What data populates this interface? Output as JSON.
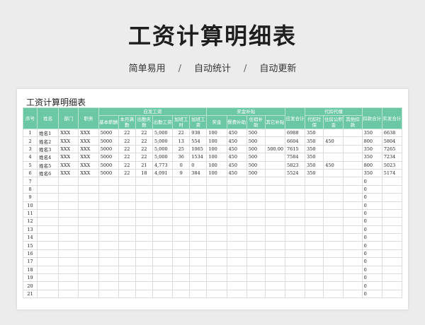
{
  "banner": {
    "title": "工资计算明细表",
    "features": [
      "简单易用",
      "自动统计",
      "自动更新"
    ],
    "separator": "/"
  },
  "sheet": {
    "title": "工资计算明细表",
    "headers": {
      "index": "序号",
      "name": "姓名",
      "dept": "部门",
      "position": "职务",
      "payable_group": "应发工资",
      "base_salary": "基本薪酬",
      "month_days": "本月满勤",
      "attendance_days": "出勤天数",
      "attendance_pay": "出勤工资",
      "overtime_hours": "加班工时",
      "overtime_pay": "加班工资",
      "bonus_group": "奖金补贴",
      "bonus": "奖金",
      "meal_allowance": "餐费补助",
      "housing_allowance": "住宿补助",
      "other_allowance": "其它补贴",
      "gross_total": "应发合计",
      "withhold_group": "代扣代缴",
      "social_insurance": "代扣社保",
      "housing_fund": "住房公积金",
      "other_deduction": "其他扣款",
      "deduction_total": "扣款合计",
      "net_total": "实发合计"
    },
    "rows": [
      {
        "no": "1",
        "name": "姓名1",
        "dept": "XXX",
        "position": "XXX",
        "base": "5000",
        "month_days": "22",
        "days": "22",
        "att_pay": "5,000",
        "ot_hours": "22",
        "ot_pay": "938",
        "bonus": "100",
        "meal": "450",
        "house": "500",
        "other": "",
        "gross": "6988",
        "social": "350",
        "fund": "",
        "other_ded": "",
        "ded_total": "350",
        "net": "6638"
      },
      {
        "no": "2",
        "name": "姓名2",
        "dept": "XXX",
        "position": "XXX",
        "base": "5000",
        "month_days": "22",
        "days": "22",
        "att_pay": "5,000",
        "ot_hours": "13",
        "ot_pay": "554",
        "bonus": "100",
        "meal": "450",
        "house": "500",
        "other": "",
        "gross": "6604",
        "social": "350",
        "fund": "450",
        "other_ded": "",
        "ded_total": "800",
        "net": "5804"
      },
      {
        "no": "3",
        "name": "姓名3",
        "dept": "XXX",
        "position": "XXX",
        "base": "5000",
        "month_days": "22",
        "days": "22",
        "att_pay": "5,000",
        "ot_hours": "25",
        "ot_pay": "1065",
        "bonus": "100",
        "meal": "450",
        "house": "500",
        "other": "500.00",
        "gross": "7615",
        "social": "350",
        "fund": "",
        "other_ded": "",
        "ded_total": "350",
        "net": "7265"
      },
      {
        "no": "4",
        "name": "姓名4",
        "dept": "XXX",
        "position": "XXX",
        "base": "5000",
        "month_days": "22",
        "days": "22",
        "att_pay": "5,000",
        "ot_hours": "36",
        "ot_pay": "1534",
        "bonus": "100",
        "meal": "450",
        "house": "500",
        "other": "",
        "gross": "7584",
        "social": "350",
        "fund": "",
        "other_ded": "",
        "ded_total": "350",
        "net": "7234"
      },
      {
        "no": "5",
        "name": "姓名5",
        "dept": "XXX",
        "position": "XXX",
        "base": "5000",
        "month_days": "22",
        "days": "21",
        "att_pay": "4,773",
        "ot_hours": "0",
        "ot_pay": "0",
        "bonus": "100",
        "meal": "450",
        "house": "500",
        "other": "",
        "gross": "5823",
        "social": "350",
        "fund": "450",
        "other_ded": "",
        "ded_total": "800",
        "net": "5023"
      },
      {
        "no": "6",
        "name": "姓名6",
        "dept": "XXX",
        "position": "XXX",
        "base": "5000",
        "month_days": "22",
        "days": "18",
        "att_pay": "4,091",
        "ot_hours": "9",
        "ot_pay": "384",
        "bonus": "100",
        "meal": "450",
        "house": "500",
        "other": "",
        "gross": "5524",
        "social": "350",
        "fund": "",
        "other_ded": "",
        "ded_total": "350",
        "net": "5174"
      },
      {
        "no": "7",
        "ded_total": "0"
      },
      {
        "no": "8",
        "ded_total": "0"
      },
      {
        "no": "9",
        "ded_total": "0"
      },
      {
        "no": "10",
        "ded_total": "0"
      },
      {
        "no": "11",
        "ded_total": "0"
      },
      {
        "no": "12",
        "ded_total": "0"
      },
      {
        "no": "13",
        "ded_total": "0"
      },
      {
        "no": "14",
        "ded_total": "0"
      },
      {
        "no": "15",
        "ded_total": "0"
      },
      {
        "no": "16",
        "ded_total": "0"
      },
      {
        "no": "17",
        "ded_total": "0"
      },
      {
        "no": "18",
        "ded_total": "0"
      },
      {
        "no": "19",
        "ded_total": "0"
      },
      {
        "no": "20",
        "ded_total": "0"
      },
      {
        "no": "21",
        "ded_total": "0"
      }
    ]
  }
}
